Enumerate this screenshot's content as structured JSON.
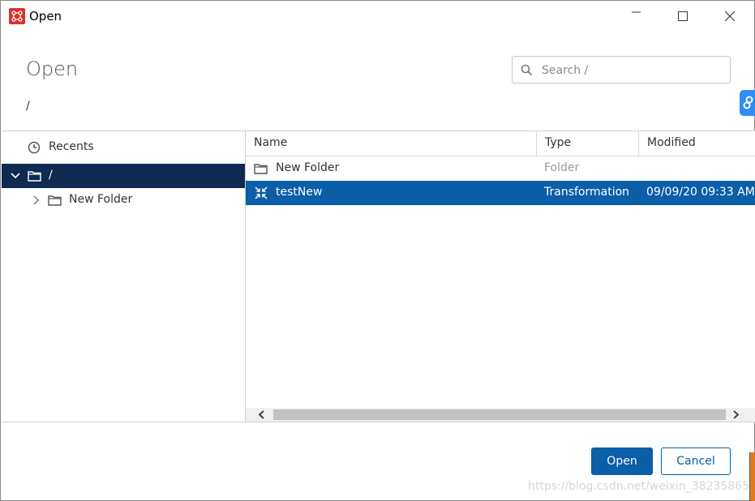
{
  "window": {
    "title": "Open",
    "controls": [
      "minimize-icon",
      "maximize-icon",
      "close-icon"
    ]
  },
  "header": {
    "heading": "Open",
    "current_path": "/",
    "search": {
      "placeholder": "Search /",
      "value": ""
    }
  },
  "sidebar": {
    "recents_label": "Recents",
    "tree": [
      {
        "label": "/",
        "expanded": true,
        "selected": true
      },
      {
        "label": "New Folder",
        "expanded": false,
        "selected": false
      }
    ]
  },
  "table": {
    "columns": [
      "Name",
      "Type",
      "Modified"
    ],
    "rows": [
      {
        "name": "New Folder",
        "type": "Folder",
        "modified": "",
        "icon": "folder-icon",
        "selected": false
      },
      {
        "name": "testNew",
        "type": "Transformation",
        "modified": "09/09/20 09:33 AM",
        "icon": "transformation-icon",
        "selected": true
      }
    ]
  },
  "footer": {
    "open_label": "Open",
    "cancel_label": "Cancel"
  },
  "watermark": "https://blog.csdn.net/weixin_38235865",
  "colors": {
    "selection_dark": "#0e2a52",
    "selection_blue": "#0b5ea8",
    "brand_red": "#d9302c",
    "side_tab": "#2f8df3"
  }
}
